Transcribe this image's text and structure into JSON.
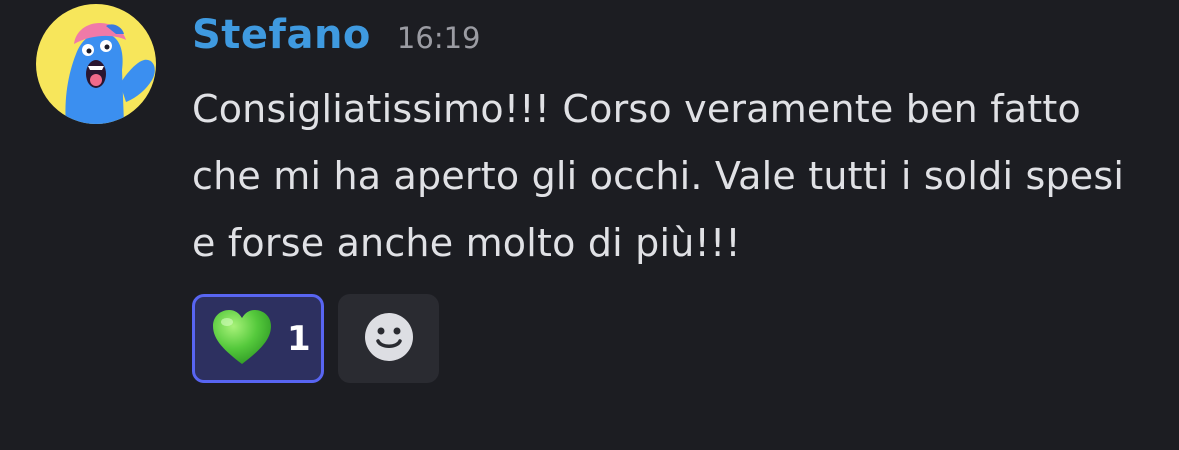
{
  "message": {
    "author": "Stefano",
    "timestamp": "16:19",
    "text": "Consigliatissimo!!! Corso veramente ben fatto che mi ha aperto gli occhi. Vale tutti i soldi spesi e forse anche molto di più!!!"
  },
  "reactions": [
    {
      "emoji": "green-heart",
      "count": "1",
      "selected": true
    }
  ],
  "colors": {
    "background": "#1c1d22",
    "username": "#3f9ae0",
    "timestamp": "#9b9ca3",
    "text": "#e0e1e5",
    "reaction_selected_bg": "#2d3060",
    "reaction_selected_border": "#5865f2",
    "avatar_bg": "#f7e65b"
  },
  "icons": {
    "avatar": "blue-cartoon-character-avatar",
    "reaction": "green-heart-icon",
    "add_reaction": "smiley-face-icon"
  }
}
